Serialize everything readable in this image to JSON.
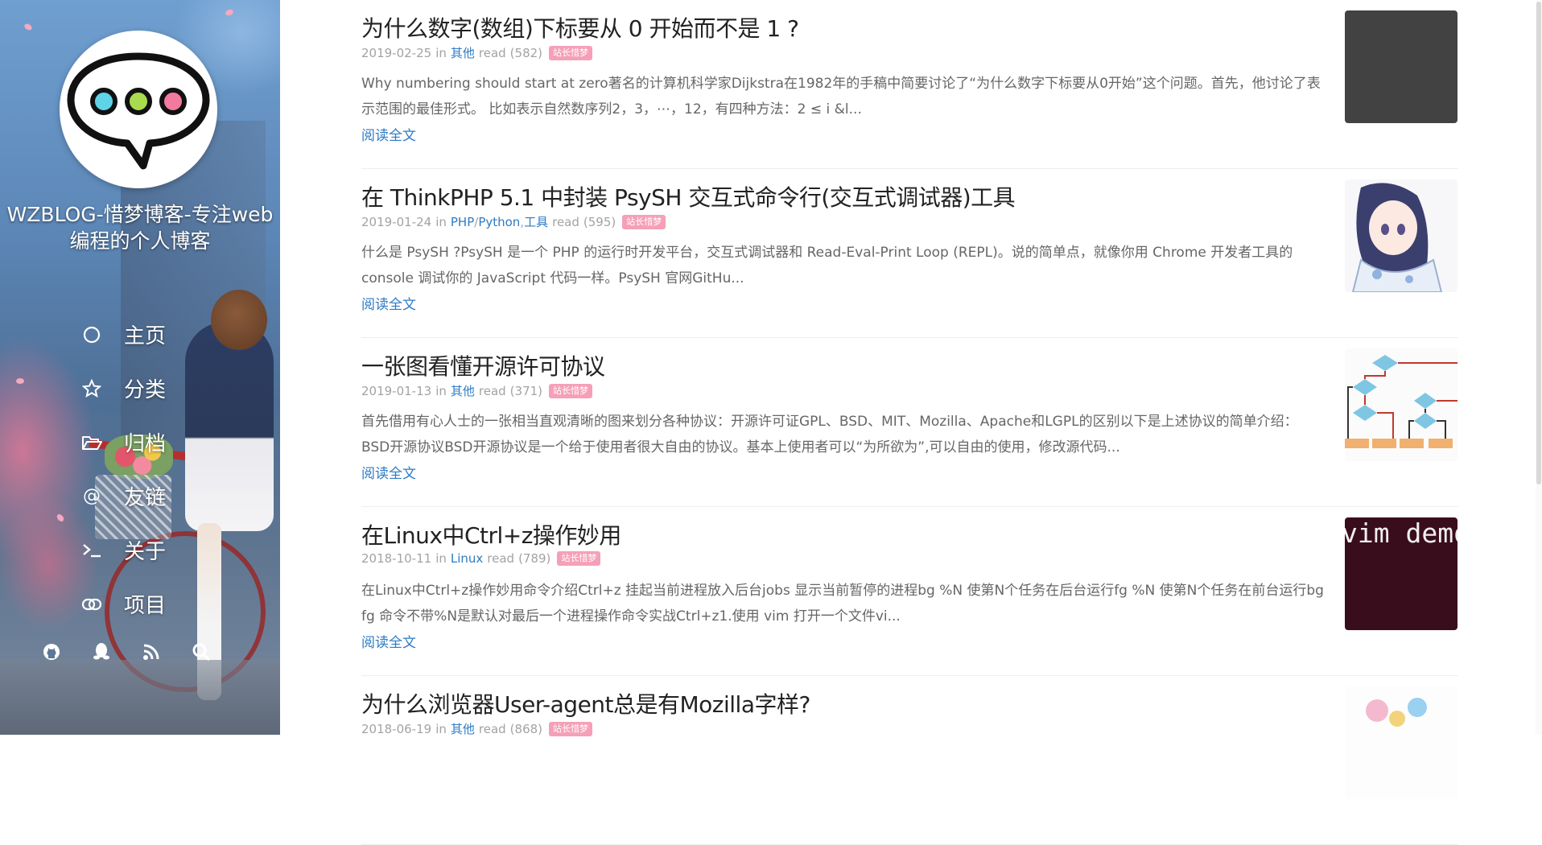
{
  "site": {
    "title": "WZBLOG-惜梦博客-专注web编程的个人博客"
  },
  "nav": [
    {
      "label": "主页",
      "icon": "circle-icon"
    },
    {
      "label": "分类",
      "icon": "star-icon"
    },
    {
      "label": "归档",
      "icon": "folder-open-icon"
    },
    {
      "label": "友链",
      "icon": "at-icon"
    },
    {
      "label": "关于",
      "icon": "terminal-icon"
    },
    {
      "label": "项目",
      "icon": "link-icon"
    }
  ],
  "social": [
    "github-icon",
    "qq-icon",
    "rss-icon",
    "search-icon"
  ],
  "read_more_label": "阅读全文",
  "badge_label": "站长惜梦",
  "meta_words": {
    "in": "in",
    "read": "read"
  },
  "colors": {
    "link": "#2d7bc4",
    "badge": "#f5a0b8",
    "meta": "#a3a3a3"
  },
  "posts": [
    {
      "title": "为什么数字(数组)下标要从 0 开始而不是 1 ?",
      "date": "2019-02-25",
      "categories": [
        "其他"
      ],
      "reads": "(582)",
      "excerpt": "Why numbering should start at zero著名的计算机科学家Dijkstra在1982年的手稿中简要讨论了“为什么数字下标要从0开始”这个问题。首先，他讨论了表示范围的最佳形式。 比如表示自然数序列2，3，⋯，12，有四种方法：2 ≤ i &l..."
    },
    {
      "title": "在 ThinkPHP 5.1 中封装 PsySH 交互式命令行(交互式调试器)工具",
      "date": "2019-01-24",
      "categories": [
        "PHP",
        "Python",
        "工具"
      ],
      "reads": "(595)",
      "excerpt": "什么是 PsySH ?PsySH 是一个 PHP 的运行时开发平台，交互式调试器和 Read-Eval-Print Loop (REPL)。说的简单点，就像你用 Chrome 开发者工具的 console 调试你的 JavaScript 代码一样。PsySH 官网GitHu..."
    },
    {
      "title": "一张图看懂开源许可协议",
      "date": "2019-01-13",
      "categories": [
        "其他"
      ],
      "reads": "(371)",
      "excerpt": "首先借用有心人士的一张相当直观清晰的图来划分各种协议：开源许可证GPL、BSD、MIT、Mozilla、Apache和LGPL的区别以下是上述协议的简单介绍：BSD开源协议BSD开源协议是一个给于使用者很大自由的协议。基本上使用者可以“为所欲为”,可以自由的使用，修改源代码..."
    },
    {
      "title": "在Linux中Ctrl+z操作妙用",
      "date": "2018-10-11",
      "categories": [
        "Linux"
      ],
      "reads": "(789)",
      "excerpt": "在Linux中Ctrl+z操作妙用命令介绍Ctrl+z 挂起当前进程放入后台jobs 显示当前暂停的进程bg %N 使第N个任务在后台运行fg %N 使第N个任务在前台运行bg fg 命令不带%N是默认对最后一个进程操作命令实战Ctrl+z1.使用 vim 打开一个文件vi...",
      "thumb_text": "vim demo"
    },
    {
      "title": "为什么浏览器User-agent总是有Mozilla字样?",
      "date": "2018-06-19",
      "categories": [
        "其他"
      ],
      "reads": "(868)",
      "excerpt": ""
    }
  ]
}
